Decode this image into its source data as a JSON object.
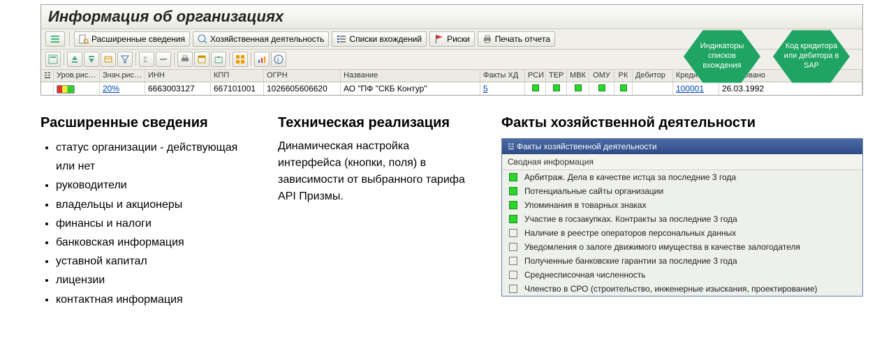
{
  "window": {
    "title": "Информация об организациях"
  },
  "toolbar": {
    "expanded": "Расширенные сведения",
    "activity": "Хозяйственная деятельность",
    "lists": "Списки вхождений",
    "risks": "Риски",
    "print": "Печать отчета"
  },
  "badges": {
    "left": "Индикаторы списков вхождения",
    "right": "Код кредитора или дебитора в SAP"
  },
  "grid": {
    "headers": {
      "risk_lvl": "Уров.рис…",
      "risk_val": "Знач.рис…",
      "inn": "ИНН",
      "kpp": "КПП",
      "ogrn": "ОГРН",
      "name": "Название",
      "facts": "Факты ХД",
      "rsi": "РСИ",
      "ter": "ТЕР",
      "mvk": "МВК",
      "omu": "ОМУ",
      "rk": "РК",
      "debtor": "Дебитор",
      "creditor": "Кредитор",
      "formed": "Образовано"
    },
    "row": {
      "risk_val": "20%",
      "inn": "6663003127",
      "kpp": "667101001",
      "ogrn": "1026605606620",
      "name": "АО \"ПФ \"СКБ Контур\"",
      "facts": "5",
      "rsi": true,
      "ter": true,
      "mvk": true,
      "omu": true,
      "rk": true,
      "debtor": "",
      "creditor": "100001",
      "formed": "26.03.1992"
    }
  },
  "section1": {
    "title": "Расширенные сведения",
    "items": [
      "статус организации - действующая или нет",
      "руководители",
      "владельцы и акционеры",
      "финансы и налоги",
      "банковская информация",
      "уставной капитал",
      "лицензии",
      "контактная информация"
    ]
  },
  "section2": {
    "title": "Техническая реализация",
    "text": "Динамическая настройка интерфейса (кнопки, поля) в зависимости от выбранного тарифа API Призмы."
  },
  "section3": {
    "title": "Факты хозяйственной деятельности",
    "panel_title": "Факты хозяйственной деятельности",
    "panel_sub": "Сводная информация",
    "rows": [
      {
        "on": true,
        "text": "Арбитраж. Дела в качестве истца за последние 3 года"
      },
      {
        "on": true,
        "text": "Потенциальные сайты организации"
      },
      {
        "on": true,
        "text": "Упоминания в товарных знаках"
      },
      {
        "on": true,
        "text": "Участие в госзакупках. Контракты за последние 3 года"
      },
      {
        "on": false,
        "text": "Наличие в реестре операторов персональных данных"
      },
      {
        "on": false,
        "text": "Уведомления о залоге движимого имущества в качестве залогодателя"
      },
      {
        "on": false,
        "text": "Полученные банковские гарантии за последние 3 года"
      },
      {
        "on": false,
        "text": "Среднесписочная численность"
      },
      {
        "on": false,
        "text": "Членство в СРО (строительство, инженерные изыскания, проектирование)"
      }
    ]
  }
}
